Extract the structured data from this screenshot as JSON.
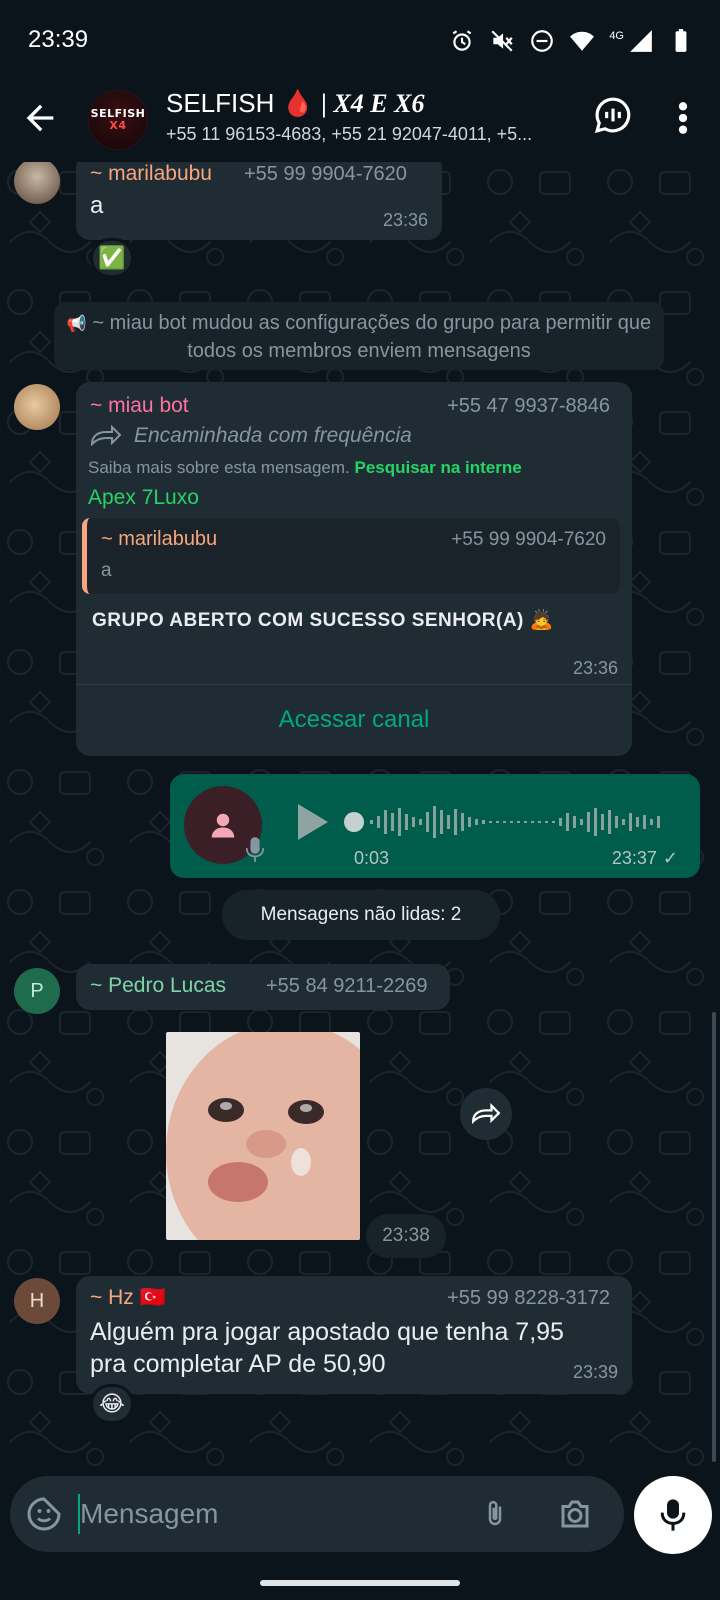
{
  "status_bar": {
    "time": "23:39",
    "network": "4G"
  },
  "header": {
    "avatar_text_top": "SELFISH",
    "avatar_text_bottom": "X4",
    "title_prefix": "SELFISH",
    "title_drop": "🩸",
    "title_suffix": "| X4 E X6",
    "subtitle": "+55 11 96153-4683, +55 21 92047-4011, +5..."
  },
  "messages": {
    "m1": {
      "sender": "~ marilabubu",
      "phone": "+55 99 9904-7620",
      "text": "a",
      "time": "23:36",
      "reaction": "✅"
    },
    "system": {
      "icon": "📢",
      "text": "~ miau bot mudou as configurações do grupo para permitir que todos os membros enviem mensagens"
    },
    "m2": {
      "sender": "~ miau bot",
      "phone": "+55 47 9937-8846",
      "forwarded": "Encaminhada com frequência",
      "info": "Saiba mais sobre esta mensagem.",
      "search_link": "Pesquisar na interne",
      "channel": "Apex 7Luxo",
      "quote_sender": "~ marilabubu",
      "quote_phone": "+55 99 9904-7620",
      "quote_text": "a",
      "text": "GRUPO ABERTO COM SUCESSO SENHOR(A) 🙇",
      "time": "23:36",
      "action": "Acessar canal"
    },
    "voice": {
      "duration": "0:03",
      "time": "23:37",
      "tick": "✓"
    },
    "unread": "Mensagens não lidas: 2",
    "m3": {
      "avatar_letter": "P",
      "sender": "~ Pedro Lucas",
      "phone": "+55 84 9211-2269",
      "time": "23:38"
    },
    "m4": {
      "avatar_letter": "H",
      "sender": "~ Hz 🇹🇷",
      "phone": "+55 99 8228-3172",
      "text_line1": "Alguém pra jogar apostado que tenha 7,95",
      "text_line2": "pra completar AP de 50,90",
      "time": "23:39",
      "reaction": "😂"
    }
  },
  "composer": {
    "placeholder": "Mensagem"
  },
  "colors": {
    "background": "#0b141a",
    "bubble_in": "#202c33",
    "bubble_out": "#005c4b",
    "accent_green": "#00a884",
    "sender_orange": "#f6a77e",
    "sender_pink": "#ff72a1",
    "sender_green": "#53bdeb",
    "link_green": "#25d366"
  }
}
